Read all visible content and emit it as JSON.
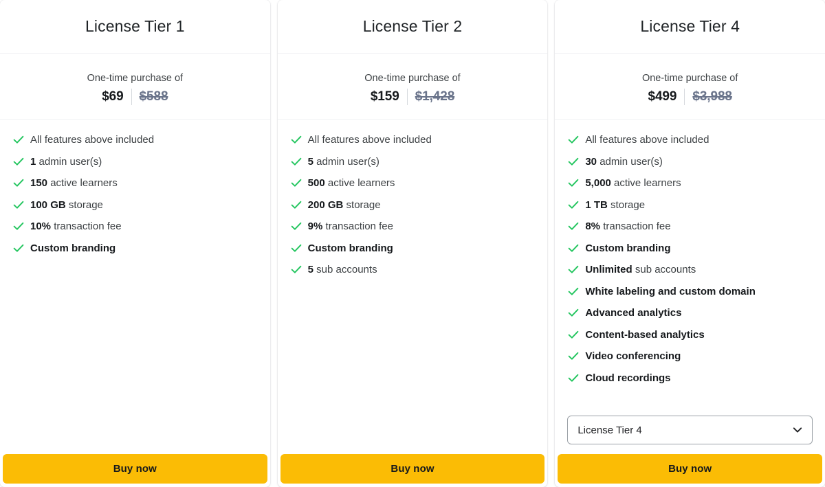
{
  "page": {
    "accent_yellow": "#FBBC05",
    "check_green": "#22C55E",
    "original_price_color": "#69738A",
    "text_color": "#3C4043"
  },
  "cards": [
    {
      "title": "License Tier 1",
      "price_caption": "One-time purchase of",
      "price_current": "$69",
      "price_original": "$588",
      "features": [
        {
          "strong": "",
          "rest": "All features above included",
          "all_bold": false
        },
        {
          "strong": "1",
          "rest": " admin user(s)",
          "all_bold": false
        },
        {
          "strong": "150",
          "rest": " active learners",
          "all_bold": false
        },
        {
          "strong": "100 GB",
          "rest": " storage",
          "all_bold": false
        },
        {
          "strong": "10%",
          "rest": " transaction fee",
          "all_bold": false
        },
        {
          "strong": "",
          "rest": "Custom branding",
          "all_bold": true
        }
      ],
      "has_select": false,
      "select_value": "",
      "buy_label": "Buy now"
    },
    {
      "title": "License Tier 2",
      "price_caption": "One-time purchase of",
      "price_current": "$159",
      "price_original": "$1,428",
      "features": [
        {
          "strong": "",
          "rest": "All features above included",
          "all_bold": false
        },
        {
          "strong": "5",
          "rest": " admin user(s)",
          "all_bold": false
        },
        {
          "strong": "500",
          "rest": " active learners",
          "all_bold": false
        },
        {
          "strong": "200 GB",
          "rest": " storage",
          "all_bold": false
        },
        {
          "strong": "9%",
          "rest": " transaction fee",
          "all_bold": false
        },
        {
          "strong": "",
          "rest": "Custom branding",
          "all_bold": true
        },
        {
          "strong": "5",
          "rest": " sub accounts",
          "all_bold": false
        }
      ],
      "has_select": false,
      "select_value": "",
      "buy_label": "Buy now"
    },
    {
      "title": "License Tier 4",
      "price_caption": "One-time purchase of",
      "price_current": "$499",
      "price_original": "$3,988",
      "features": [
        {
          "strong": "",
          "rest": "All features above included",
          "all_bold": false
        },
        {
          "strong": "30",
          "rest": " admin user(s)",
          "all_bold": false
        },
        {
          "strong": "5,000",
          "rest": " active learners",
          "all_bold": false
        },
        {
          "strong": "1 TB",
          "rest": " storage",
          "all_bold": false
        },
        {
          "strong": "8%",
          "rest": " transaction fee",
          "all_bold": false
        },
        {
          "strong": "",
          "rest": "Custom branding",
          "all_bold": true
        },
        {
          "strong": "Unlimited",
          "rest": " sub accounts",
          "all_bold": false
        },
        {
          "strong": "",
          "rest": "White labeling and custom domain",
          "all_bold": true
        },
        {
          "strong": "",
          "rest": "Advanced analytics",
          "all_bold": true
        },
        {
          "strong": "",
          "rest": "Content-based analytics",
          "all_bold": true
        },
        {
          "strong": "",
          "rest": "Video conferencing",
          "all_bold": true
        },
        {
          "strong": "",
          "rest": "Cloud recordings",
          "all_bold": true
        }
      ],
      "has_select": true,
      "select_value": "License Tier 4",
      "buy_label": "Buy now"
    }
  ]
}
